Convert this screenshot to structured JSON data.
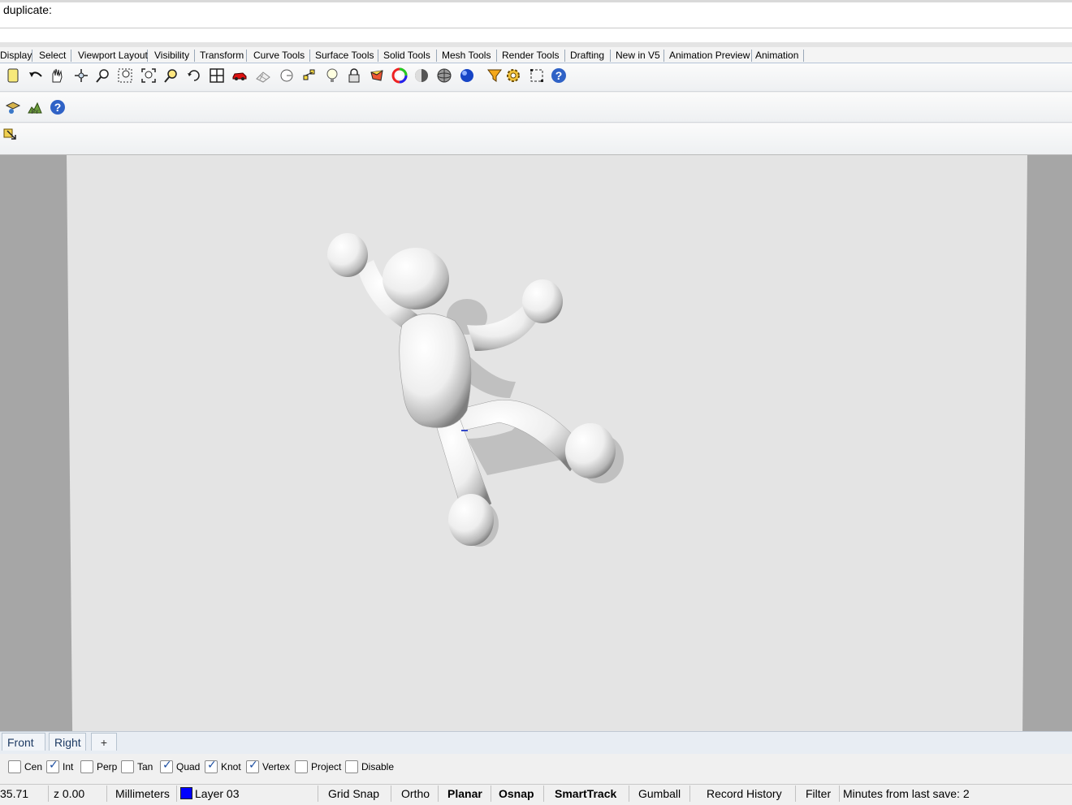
{
  "command": {
    "prompt": "duplicate:"
  },
  "toolbar_tabs": [
    "Display",
    "Select",
    "Viewport Layout",
    "Visibility",
    "Transform",
    "Curve Tools",
    "Surface Tools",
    "Solid Tools",
    "Mesh Tools",
    "Render Tools",
    "Drafting",
    "New in V5",
    "Animation Preview",
    "Animation"
  ],
  "toolbar_icons": [
    "new-file-icon",
    "undo-icon",
    "pan-icon",
    "rotate-view-icon",
    "zoom-icon",
    "zoom-window-icon",
    "zoom-extents-icon",
    "zoom-selected-icon",
    "undo-view-icon",
    "four-viewports-icon",
    "car-render-icon",
    "grid-icon",
    "circle-snap-icon",
    "points-icon",
    "light-icon",
    "lock-icon",
    "paint-icon",
    "color-wheel-icon",
    "shaded-sphere-icon",
    "ghosted-sphere-icon",
    "rendered-sphere-icon",
    "funnel-icon",
    "settings-icon",
    "box-select-icon",
    "help-icon"
  ],
  "second_toolbar_icons": [
    "layers-icon",
    "python-icon",
    "help-icon"
  ],
  "third_toolbar_icons": [
    "arrow-drag-icon"
  ],
  "colors": {
    "viewport_bg": "#e4e4e4",
    "viewport_frame": "#a6a6a6",
    "layer_color": "#0000ff",
    "tab_text": "#1d3a63"
  },
  "view_tabs": [
    "Front",
    "Right"
  ],
  "view_tab_add": "+",
  "osnap": [
    {
      "label": "Cen",
      "checked": false
    },
    {
      "label": "Int",
      "checked": true
    },
    {
      "label": "Perp",
      "checked": false
    },
    {
      "label": "Tan",
      "checked": false
    },
    {
      "label": "Quad",
      "checked": true
    },
    {
      "label": "Knot",
      "checked": true
    },
    {
      "label": "Vertex",
      "checked": true
    },
    {
      "label": "Project",
      "checked": false
    },
    {
      "label": "Disable",
      "checked": false
    }
  ],
  "status": {
    "y_coord": "35.71",
    "z_coord": "z 0.00",
    "units": "Millimeters",
    "layer": "Layer 03",
    "grid_snap": "Grid Snap",
    "ortho": "Ortho",
    "planar": "Planar",
    "osnap": "Osnap",
    "smarttrack": "SmartTrack",
    "gumball": "Gumball",
    "record_history": "Record History",
    "filter": "Filter",
    "save_info": "Minutes from last save: 2"
  }
}
